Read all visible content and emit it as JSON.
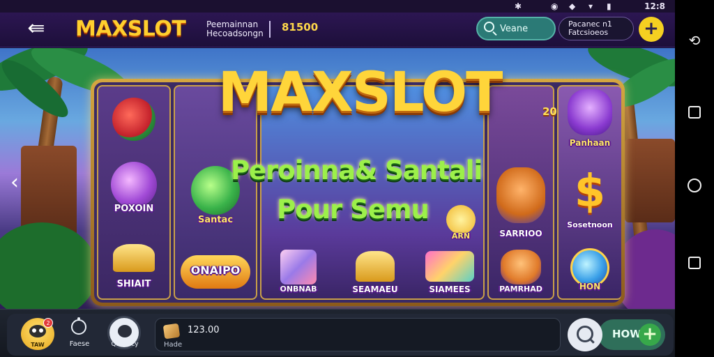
{
  "status_bar": {
    "time": "12:8",
    "icons": [
      "bluetooth-icon",
      "alarm-icon",
      "wifi-icon",
      "signal-icon",
      "battery-icon"
    ]
  },
  "header": {
    "logo": "MAXSLOT",
    "info_line1": "Peemainnan",
    "info_line2": "Hecoadsongn",
    "balance": "81500",
    "search_placeholder": "Veane",
    "promo_line1": "Pacanec n1",
    "promo_line2": "Fatcsioeos"
  },
  "banner": {
    "title": "MAXSLOT",
    "badge": "20",
    "tagline_line1": "Peroinna& Santali",
    "tagline_line2": "Pour Semu"
  },
  "reels": {
    "left": [
      {
        "name": "watermelon",
        "label": ""
      },
      {
        "name": "purple-swirl",
        "label": "POXOIN"
      },
      {
        "name": "gold-bar",
        "label": "SHIAIT"
      }
    ],
    "left2": [
      {
        "name": "green-gem",
        "label": "Santac"
      },
      {
        "name": "oranpo-gem",
        "label": "ONAIPO"
      }
    ],
    "middle": [
      {
        "name": "crystal",
        "label": "ONBNAB"
      },
      {
        "name": "gold-ingot",
        "label": "SEAMAEU"
      },
      {
        "name": "chest",
        "label": "SIAMEES"
      }
    ],
    "right": [
      {
        "name": "purple-cat",
        "label": "Panhaan"
      },
      {
        "name": "dollar",
        "label": "Sosetnoon"
      },
      {
        "name": "swirl-orb",
        "label": "HON"
      }
    ],
    "right2": [
      {
        "name": "fox-mascot",
        "label": "SARRIOO"
      },
      {
        "name": "tiger",
        "label": "PAMRHAD"
      }
    ],
    "sun_label": "ARN"
  },
  "bottom_bar": {
    "avatar_badge": "2",
    "avatar_tag": "TAW",
    "home_label": "Faese",
    "games_label": "Qalloncy",
    "wallet_amount": "123.00",
    "wallet_sub": "Hade",
    "play_label": "HOW"
  },
  "colors": {
    "gold": "#ffd53a",
    "lime": "#9cf04a",
    "teal": "#2b7a76",
    "purple": "#2c1652"
  }
}
